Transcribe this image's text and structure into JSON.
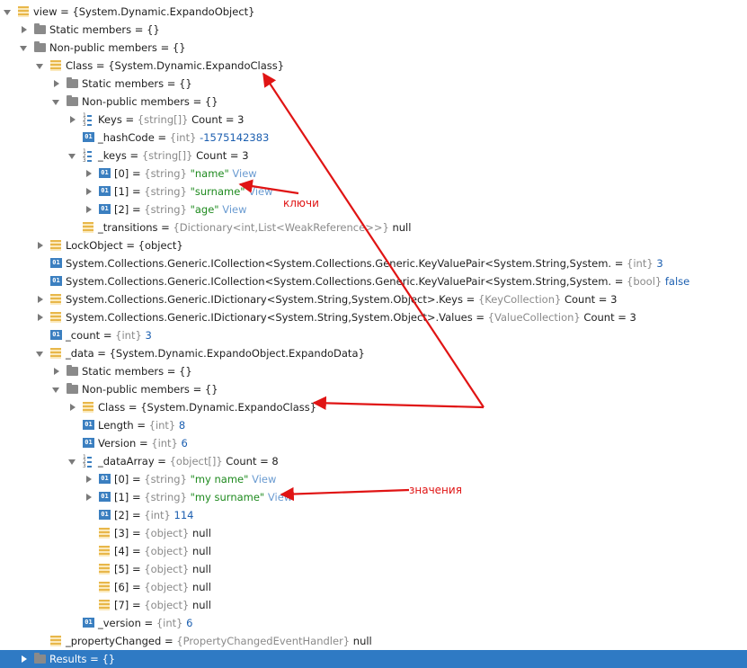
{
  "rows": [
    {
      "name": "view",
      "type": "{System.Dynamic.ExpandoObject}"
    },
    {
      "name": "Static members",
      "type": "{}"
    },
    {
      "name": "Non-public members",
      "type": "{}"
    },
    {
      "name": "Class",
      "type": "{System.Dynamic.ExpandoClass}"
    },
    {
      "name": "Static members",
      "type": "{}"
    },
    {
      "name": "Non-public members",
      "type": "{}"
    },
    {
      "name": "Keys",
      "type": "{string[]}",
      "extra": "Count = 3"
    },
    {
      "name": "_hashCode",
      "type": "{int}",
      "value": "-1575142383"
    },
    {
      "name": "_keys",
      "type": "{string[]}",
      "extra": "Count = 3"
    },
    {
      "name": "[0]",
      "type": "{string}",
      "value": "\"name\"",
      "link": "View"
    },
    {
      "name": "[1]",
      "type": "{string}",
      "value": "\"surname\"",
      "link": "View"
    },
    {
      "name": "[2]",
      "type": "{string}",
      "value": "\"age\"",
      "link": "View"
    },
    {
      "name": "_transitions",
      "type": "{Dictionary<int,List<WeakReference>>}",
      "extra": "null"
    },
    {
      "name": "LockObject",
      "type": "{object}"
    },
    {
      "name": "System.Collections.Generic.ICollection<System.Collections.Generic.KeyValuePair<System.String,System.",
      "type": "{int}",
      "value": "3"
    },
    {
      "name": "System.Collections.Generic.ICollection<System.Collections.Generic.KeyValuePair<System.String,System.",
      "type": "{bool}",
      "value": "false"
    },
    {
      "name": "System.Collections.Generic.IDictionary<System.String,System.Object>.Keys",
      "type": "{KeyCollection}",
      "extra": "Count = 3"
    },
    {
      "name": "System.Collections.Generic.IDictionary<System.String,System.Object>.Values",
      "type": "{ValueCollection}",
      "extra": "Count = 3"
    },
    {
      "name": "_count",
      "type": "{int}",
      "value": "3"
    },
    {
      "name": "_data",
      "type": "{System.Dynamic.ExpandoObject.ExpandoData}"
    },
    {
      "name": "Static members",
      "type": "{}"
    },
    {
      "name": "Non-public members",
      "type": "{}"
    },
    {
      "name": "Class",
      "type": "{System.Dynamic.ExpandoClass}"
    },
    {
      "name": "Length",
      "type": "{int}",
      "value": "8"
    },
    {
      "name": "Version",
      "type": "{int}",
      "value": "6"
    },
    {
      "name": "_dataArray",
      "type": "{object[]}",
      "extra": "Count = 8"
    },
    {
      "name": "[0]",
      "type": "{string}",
      "value": "\"my name\"",
      "link": "View"
    },
    {
      "name": "[1]",
      "type": "{string}",
      "value": "\"my surname\"",
      "link": "View"
    },
    {
      "name": "[2]",
      "type": "{int}",
      "value": "114"
    },
    {
      "name": "[3]",
      "type": "{object}",
      "extra": "null"
    },
    {
      "name": "[4]",
      "type": "{object}",
      "extra": "null"
    },
    {
      "name": "[5]",
      "type": "{object}",
      "extra": "null"
    },
    {
      "name": "[6]",
      "type": "{object}",
      "extra": "null"
    },
    {
      "name": "[7]",
      "type": "{object}",
      "extra": "null"
    },
    {
      "name": "_version",
      "type": "{int}",
      "value": "6"
    },
    {
      "name": "_propertyChanged",
      "type": "{PropertyChangedEventHandler}",
      "extra": "null"
    },
    {
      "name": "Results",
      "type": "{}"
    }
  ],
  "annotations": {
    "keys": "ключи",
    "values": "значения"
  },
  "colors": {
    "selection": "#2f7ac4",
    "annotation": "#e01414",
    "string": "#1e8a1e",
    "number": "#1c5fb0"
  }
}
